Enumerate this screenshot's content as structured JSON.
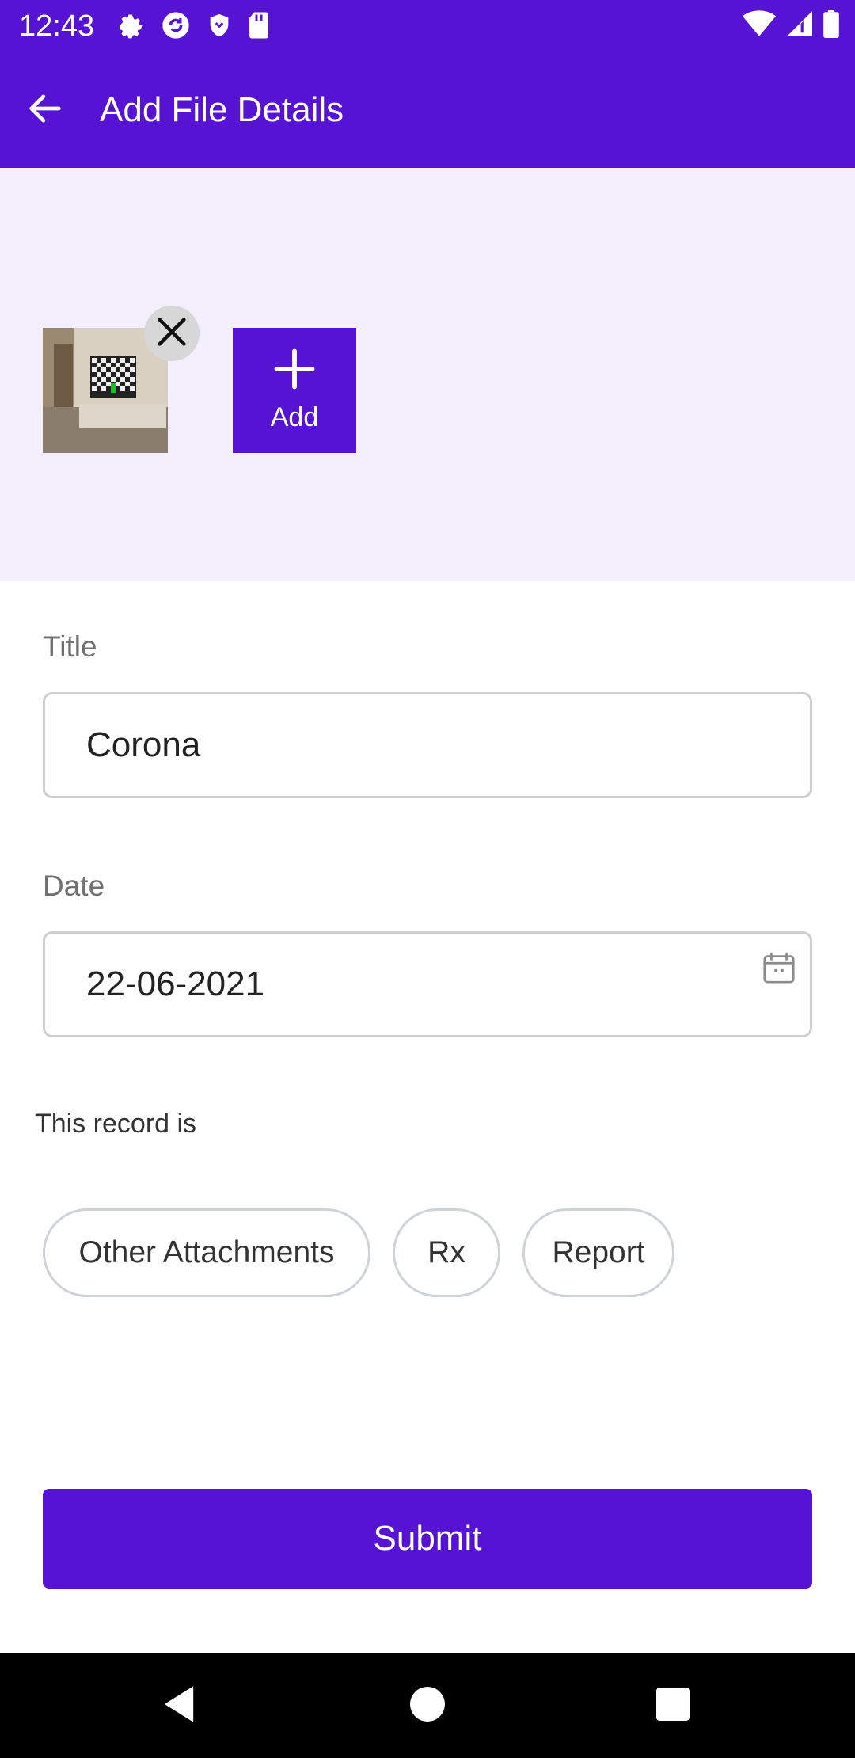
{
  "status_bar": {
    "time": "12:43",
    "left_icons": [
      "settings-icon",
      "sync-icon",
      "shield-icon",
      "sd-card-icon"
    ],
    "right_icons": [
      "wifi-icon",
      "cellular-signal-icon",
      "battery-icon"
    ]
  },
  "app_bar": {
    "title": "Add File Details",
    "back_icon": "arrow-back-icon"
  },
  "attachments": {
    "add_label": "Add",
    "add_icon": "plus-icon",
    "remove_icon": "close-icon"
  },
  "form": {
    "title_label": "Title",
    "title_value": "Corona",
    "date_label": "Date",
    "date_value": "22-06-2021",
    "record_label": "This record is",
    "record_types": [
      "Other Attachments",
      "Rx",
      "Report"
    ]
  },
  "submit_label": "Submit",
  "nav_bar": {
    "icons": [
      "back-triangle-icon",
      "home-circle-icon",
      "recents-square-icon"
    ]
  },
  "colors": {
    "primary": "#5613d3",
    "attach_background": "#f3effc",
    "nav_background": "#000000"
  }
}
